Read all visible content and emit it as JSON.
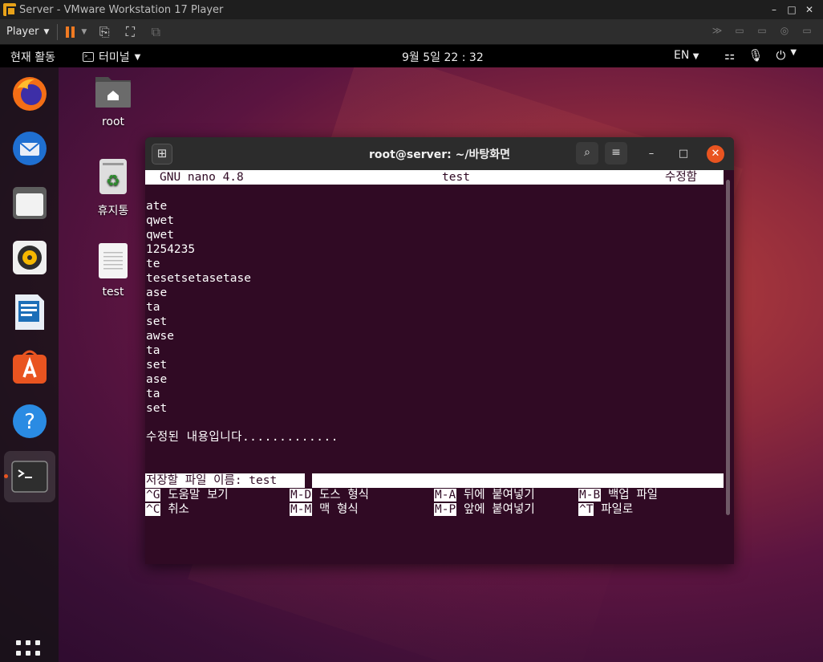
{
  "vmware": {
    "title": "Server - VMware Workstation 17 Player",
    "player_label": "Player",
    "controls": {
      "minimize": "–",
      "maximize": "□",
      "close": "✕"
    }
  },
  "topbar": {
    "activities": "현재 활동",
    "app_name": "터미널",
    "clock": "9월 5일  22 : 32",
    "language": "EN"
  },
  "desktop": {
    "icons": [
      {
        "label": "root"
      },
      {
        "label": "휴지통"
      },
      {
        "label": "test"
      }
    ]
  },
  "terminal": {
    "title": "root@server: ~/바탕화면",
    "nano_version": "GNU nano 4.8",
    "file_name": "test",
    "modified": "수정함",
    "lines": [
      "ate",
      "qwet",
      "qwet",
      "1254235",
      "te",
      "tesetsetasetase",
      "ase",
      "ta",
      "set",
      "awse",
      "ta",
      "set",
      "ase",
      "ta",
      "set"
    ],
    "edited_line": "수정된 내용입니다.............",
    "prompt": "저장할 파일 이름: test",
    "shortcuts": [
      {
        "key": "^G",
        "label": "도움말 보기"
      },
      {
        "key": "M-D",
        "label": "도스 형식"
      },
      {
        "key": "M-A",
        "label": "뒤에 붙여넣기"
      },
      {
        "key": "M-B",
        "label": "백업 파일"
      },
      {
        "key": "^C",
        "label": "취소"
      },
      {
        "key": "M-M",
        "label": "맥 형식"
      },
      {
        "key": "M-P",
        "label": "앞에 붙여넣기"
      },
      {
        "key": "^T",
        "label": "파일로"
      }
    ]
  },
  "colors": {
    "terminal_bg": "#300a24",
    "accent": "#e95420",
    "pause": "#f07a22"
  }
}
